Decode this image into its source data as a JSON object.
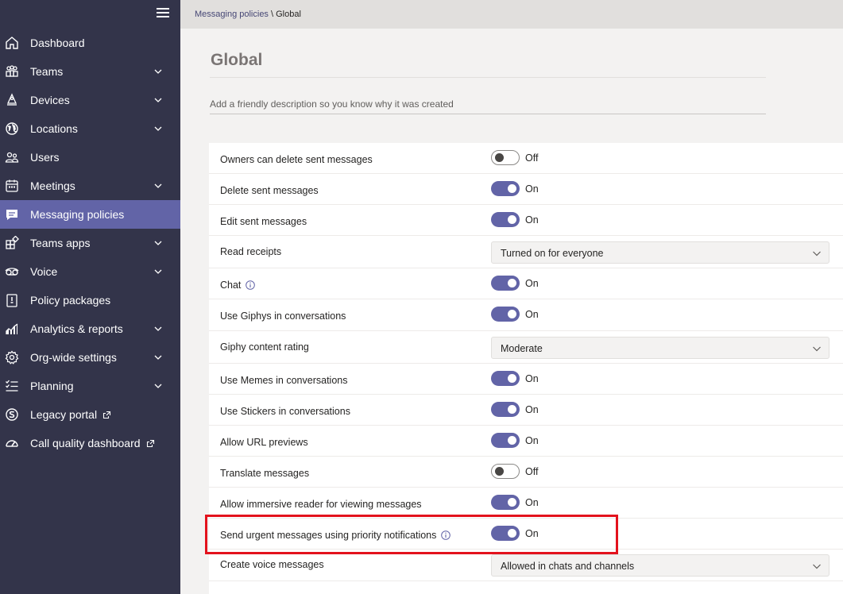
{
  "sidebar": {
    "items": [
      {
        "label": "Dashboard",
        "icon": "home-icon",
        "chevron": false
      },
      {
        "label": "Teams",
        "icon": "teams-icon",
        "chevron": true
      },
      {
        "label": "Devices",
        "icon": "devices-icon",
        "chevron": true
      },
      {
        "label": "Locations",
        "icon": "globe-icon",
        "chevron": true
      },
      {
        "label": "Users",
        "icon": "users-icon",
        "chevron": false
      },
      {
        "label": "Meetings",
        "icon": "calendar-icon",
        "chevron": true
      },
      {
        "label": "Messaging policies",
        "icon": "message-icon",
        "chevron": false,
        "active": true
      },
      {
        "label": "Teams apps",
        "icon": "apps-icon",
        "chevron": true
      },
      {
        "label": "Voice",
        "icon": "voicemail-icon",
        "chevron": true
      },
      {
        "label": "Policy packages",
        "icon": "package-icon",
        "chevron": false
      },
      {
        "label": "Analytics & reports",
        "icon": "chart-icon",
        "chevron": true
      },
      {
        "label": "Org-wide settings",
        "icon": "gear-icon",
        "chevron": true
      },
      {
        "label": "Planning",
        "icon": "checklist-icon",
        "chevron": true
      },
      {
        "label": "Legacy portal",
        "icon": "skype-icon",
        "chevron": false,
        "external": true
      },
      {
        "label": "Call quality dashboard",
        "icon": "gauge-icon",
        "chevron": false,
        "external": true
      }
    ]
  },
  "breadcrumb": {
    "parent": "Messaging policies",
    "separator": " \\ ",
    "current": "Global"
  },
  "page": {
    "title": "Global",
    "description_placeholder": "Add a friendly description so you know why it was created"
  },
  "settings": [
    {
      "label": "Owners can delete sent messages",
      "type": "toggle",
      "on": false,
      "state": "Off"
    },
    {
      "label": "Delete sent messages",
      "type": "toggle",
      "on": true,
      "state": "On"
    },
    {
      "label": "Edit sent messages",
      "type": "toggle",
      "on": true,
      "state": "On"
    },
    {
      "label": "Read receipts",
      "type": "dropdown",
      "value": "Turned on for everyone"
    },
    {
      "label": "Chat",
      "type": "toggle",
      "on": true,
      "state": "On",
      "info": true
    },
    {
      "label": "Use Giphys in conversations",
      "type": "toggle",
      "on": true,
      "state": "On"
    },
    {
      "label": "Giphy content rating",
      "type": "dropdown",
      "value": "Moderate"
    },
    {
      "label": "Use Memes in conversations",
      "type": "toggle",
      "on": true,
      "state": "On"
    },
    {
      "label": "Use Stickers in conversations",
      "type": "toggle",
      "on": true,
      "state": "On"
    },
    {
      "label": "Allow URL previews",
      "type": "toggle",
      "on": true,
      "state": "On"
    },
    {
      "label": "Translate messages",
      "type": "toggle",
      "on": false,
      "state": "Off"
    },
    {
      "label": "Allow immersive reader for viewing messages",
      "type": "toggle",
      "on": true,
      "state": "On"
    },
    {
      "label": "Send urgent messages using priority notifications",
      "type": "toggle",
      "on": true,
      "state": "On",
      "info": true,
      "highlighted": true
    },
    {
      "label": "Create voice messages",
      "type": "dropdown",
      "value": "Allowed in chats and channels"
    }
  ],
  "colors": {
    "sidebar": "#33344a",
    "accent": "#6264a7",
    "highlight": "#e3121d"
  }
}
